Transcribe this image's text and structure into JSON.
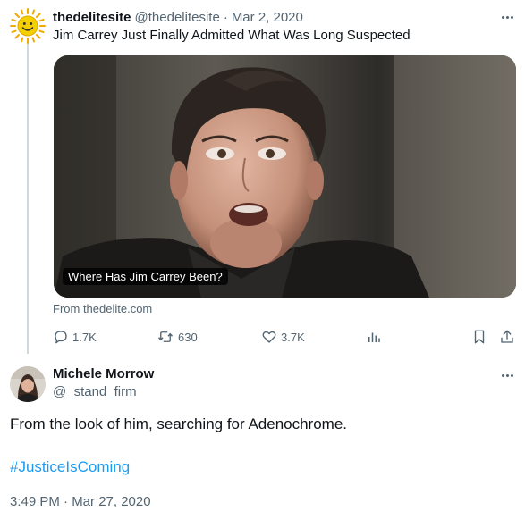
{
  "quoted_tweet": {
    "author_name": "thedelitesite",
    "author_handle": "@thedelitesite",
    "separator": "·",
    "date": "Mar 2, 2020",
    "text": "Jim Carrey Just Finally Admitted What Was Long Suspected",
    "card": {
      "caption": "Where Has Jim Carrey Been?",
      "source": "From thedelite.com"
    },
    "actions": {
      "replies": "1.7K",
      "retweets": "630",
      "likes": "3.7K"
    },
    "icons": [
      "sun-avatar-icon",
      "more-icon",
      "reply-icon",
      "retweet-icon",
      "like-icon",
      "views-icon",
      "bookmark-icon",
      "share-icon"
    ]
  },
  "reply_tweet": {
    "author_name": "Michele Morrow",
    "author_handle": "@_stand_firm",
    "text": "From the look of him, searching for Adenochrome.",
    "hashtag": "#JusticeIsComing",
    "timestamp": "3:49 PM · Mar 27, 2020"
  },
  "colors": {
    "text_primary": "#0f1419",
    "text_secondary": "#536471",
    "link": "#1d9bf0",
    "divider": "#cfd9de",
    "sun_yellow": "#f5d000"
  }
}
